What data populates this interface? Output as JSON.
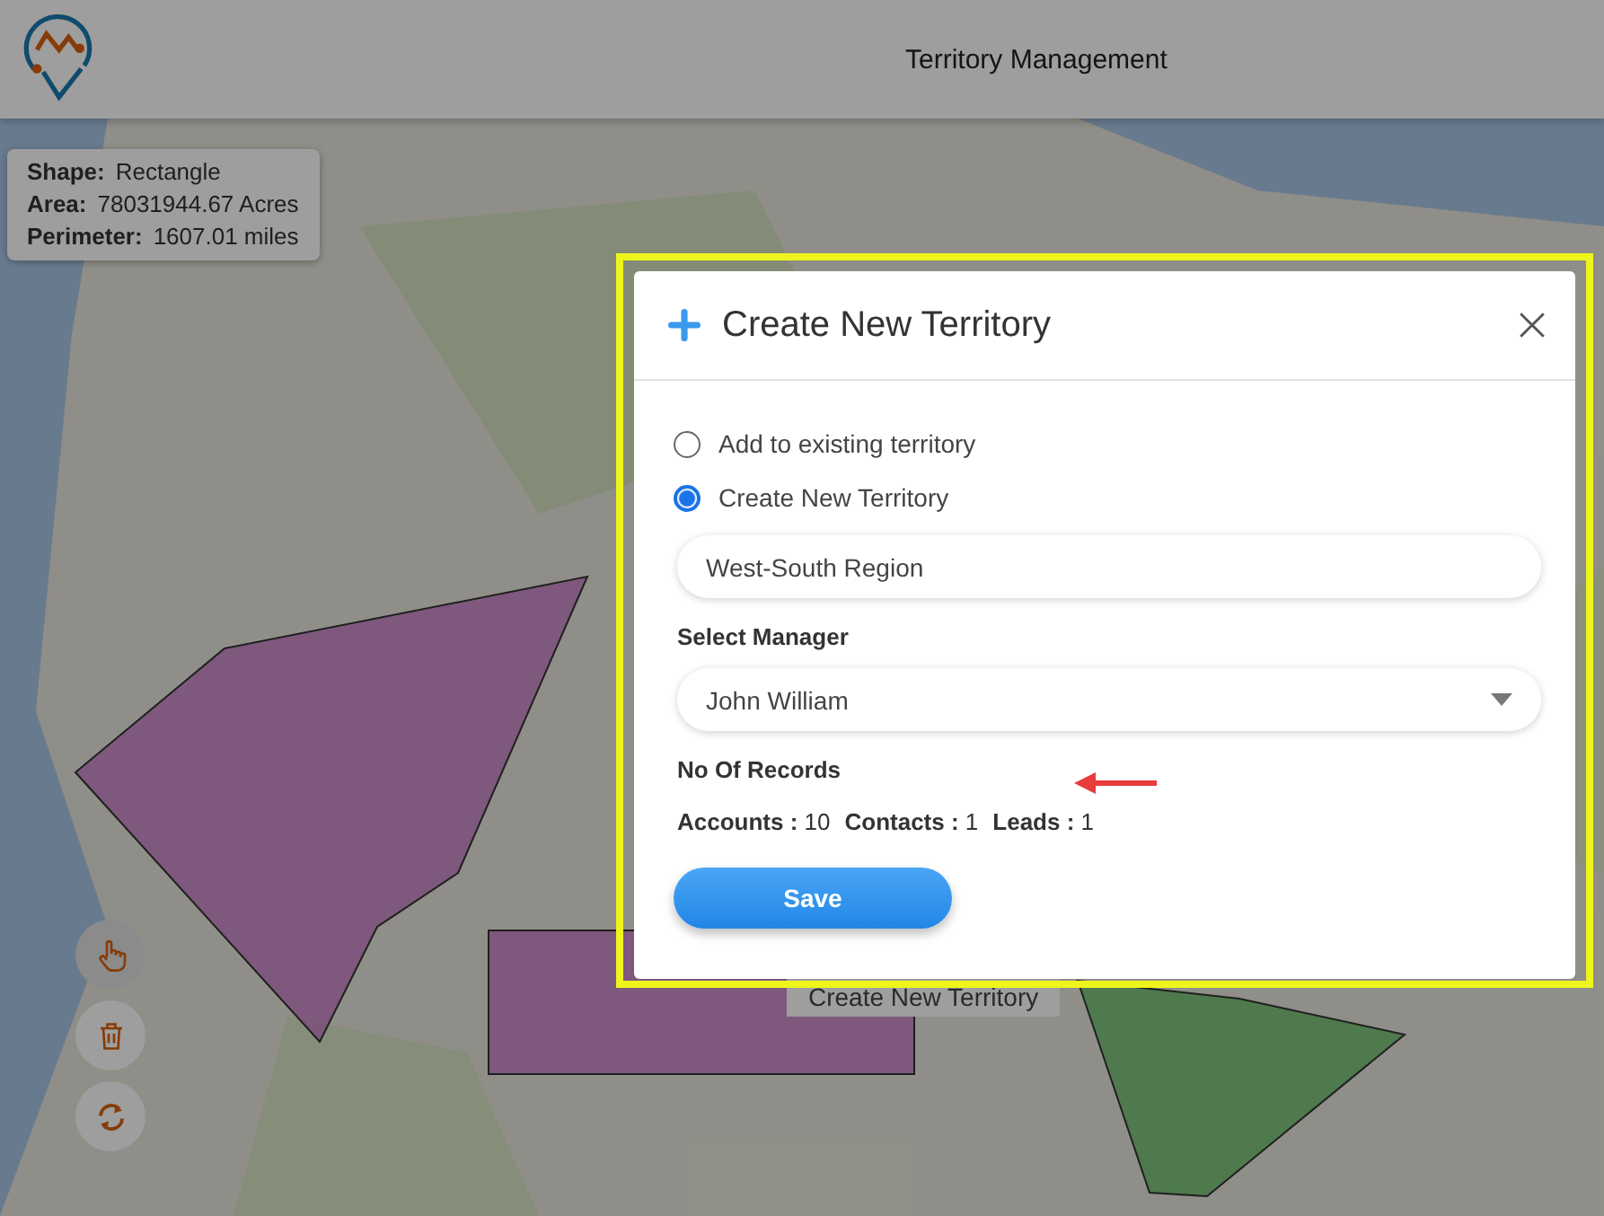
{
  "header": {
    "title": "Territory Management"
  },
  "shape_info": [
    {
      "label": "Shape:",
      "value": "Rectangle"
    },
    {
      "label": "Area:",
      "value": "78031944.67 Acres"
    },
    {
      "label": "Perimeter:",
      "value": "1607.01 miles"
    }
  ],
  "map_tools": [
    {
      "kind": "hand",
      "selected": true
    },
    {
      "kind": "trash",
      "selected": false
    },
    {
      "kind": "refresh",
      "selected": false
    }
  ],
  "map_tooltip": "Create New Territory",
  "dialog": {
    "title": "Create New Territory",
    "options": [
      {
        "label": "Add to existing territory",
        "selected": false
      },
      {
        "label": "Create New Territory",
        "selected": true
      }
    ],
    "name_value": "West-South Region",
    "manager_label": "Select Manager",
    "manager_value": "John William",
    "records_label": "No Of Records",
    "records": [
      {
        "label": "Accounts :",
        "value": "10"
      },
      {
        "label": "Contacts :",
        "value": "1"
      },
      {
        "label": "Leads :",
        "value": "1"
      }
    ],
    "save": "Save"
  }
}
